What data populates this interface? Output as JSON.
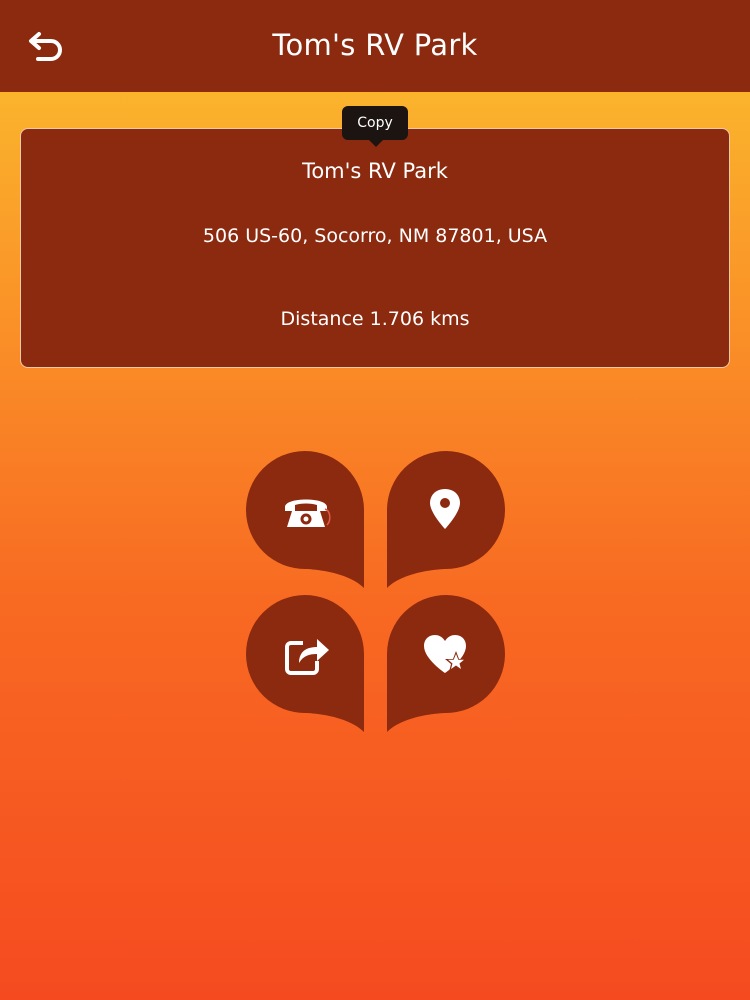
{
  "header": {
    "title": "Tom's RV Park",
    "back_icon": "back-arrow-icon"
  },
  "card": {
    "name": "Tom's RV Park",
    "address": "506 US-60, Socorro, NM 87801, USA",
    "distance": "Distance 1.706 kms"
  },
  "tooltip": {
    "label": "Copy"
  },
  "actions": [
    {
      "name": "call",
      "icon": "phone-icon"
    },
    {
      "name": "map",
      "icon": "location-pin-icon"
    },
    {
      "name": "share",
      "icon": "share-icon"
    },
    {
      "name": "favorite",
      "icon": "heart-star-icon"
    }
  ],
  "colors": {
    "header_bg": "#8c2a0f",
    "card_bg": "#8c2a0f",
    "gradient_top": "#fbc12e",
    "gradient_bottom": "#f54a20",
    "text": "#ffffff"
  }
}
